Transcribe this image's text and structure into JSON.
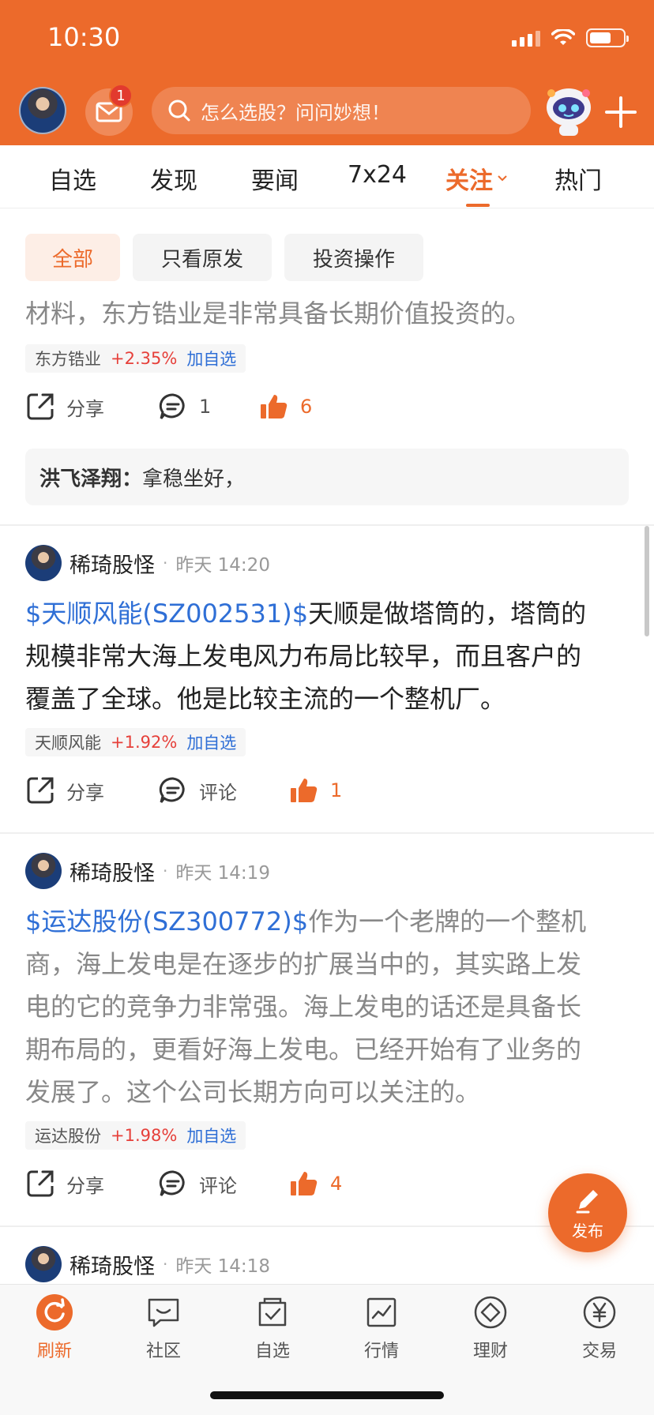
{
  "status_bar": {
    "time": "10:30"
  },
  "header": {
    "mail_badge": "1",
    "search_placeholder": "怎么选股？问问妙想！"
  },
  "tabs": [
    {
      "label": "自选"
    },
    {
      "label": "发现"
    },
    {
      "label": "要闻"
    },
    {
      "label": "7x24"
    },
    {
      "label": "关注",
      "active": true
    },
    {
      "label": "热门"
    }
  ],
  "filters": [
    {
      "label": "全部",
      "active": true
    },
    {
      "label": "只看原发"
    },
    {
      "label": "投资操作"
    }
  ],
  "post0": {
    "text_tail": "材料，东方锆业是非常具备长期价值投资的。",
    "tag": {
      "name": "东方锆业",
      "change": "+2.35%",
      "add": "加自选"
    },
    "share": "分享",
    "comments": "1",
    "likes": "6",
    "reply": {
      "author": "洪飞泽翔：",
      "text": "拿稳坐好，"
    }
  },
  "post1": {
    "user": "稀琦股怪",
    "dot": "·",
    "time": "昨天 14:20",
    "stock_link": "$天顺风能(SZ002531)$",
    "text_line1_tail": "天顺是做塔筒的，塔筒的",
    "text_line2": "规模非常大海上发电风力布局比较早，而且客户的",
    "text_line3": "覆盖了全球。他是比较主流的一个整机厂。",
    "tag": {
      "name": "天顺风能",
      "change": "+1.92%",
      "add": "加自选"
    },
    "share": "分享",
    "comment": "评论",
    "likes": "1"
  },
  "post2": {
    "user": "稀琦股怪",
    "dot": "·",
    "time": "昨天 14:19",
    "stock_link": "$运达股份(SZ300772)$",
    "text_line1_tail": "作为一个老牌的一个整机",
    "text_line2": "商，海上发电是在逐步的扩展当中的，其实路上发",
    "text_line3": "电的它的竞争力非常强。海上发电的话还是具备长",
    "text_line4": "期布局的，更看好海上发电。已经开始有了业务的",
    "text_line5": "发展了。这个公司长期方向可以关注的。",
    "tag": {
      "name": "运达股份",
      "change": "+1.98%",
      "add": "加自选"
    },
    "share": "分享",
    "comment": "评论",
    "likes": "4"
  },
  "post3": {
    "user": "稀琦股怪",
    "dot": "·",
    "time": "昨天 14:18"
  },
  "fab": {
    "label": "发布"
  },
  "bottom_nav": [
    {
      "label": "刷新",
      "icon": "refresh-icon",
      "active": true
    },
    {
      "label": "社区",
      "icon": "community-icon"
    },
    {
      "label": "自选",
      "icon": "watchlist-icon"
    },
    {
      "label": "行情",
      "icon": "market-icon"
    },
    {
      "label": "理财",
      "icon": "wealth-icon"
    },
    {
      "label": "交易",
      "icon": "trade-icon"
    }
  ],
  "colors": {
    "brand": "#ec6a2b",
    "link": "#2f6fd6",
    "rise": "#e6403a"
  }
}
